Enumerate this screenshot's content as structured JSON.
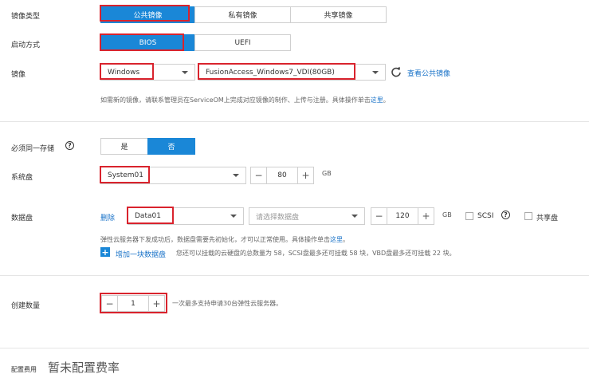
{
  "image_type": {
    "label": "镜像类型",
    "options": [
      "公共镜像",
      "私有镜像",
      "共享镜像"
    ],
    "selected": "公共镜像"
  },
  "boot_mode": {
    "label": "启动方式",
    "options": [
      "BIOS",
      "UEFI"
    ],
    "selected": "BIOS"
  },
  "image": {
    "label": "镜像",
    "os_value": "Windows",
    "image_value": "FusionAccess_Windows7_VDI(80GB)",
    "view_public_link": "查看公共镜像",
    "hint_prefix": "如需新的镜像，请联系管理员在ServiceOM上完成对应镜像的制作、上传与注册。具体操作单击",
    "hint_link": "这里",
    "hint_suffix": "。"
  },
  "same_storage": {
    "label": "必须同一存储",
    "options": [
      "是",
      "否"
    ],
    "selected": "否"
  },
  "system_disk": {
    "label": "系统盘",
    "type_value": "System01",
    "size": "80",
    "unit": "GB"
  },
  "data_disk": {
    "label": "数据盘",
    "delete_label": "删除",
    "type_value": "Data01",
    "select_placeholder": "请选择数据盘",
    "size": "120",
    "unit": "GB",
    "scsi_label": "SCSI",
    "shared_label": "共享盘",
    "hint_prefix": "弹性云服务器下发成功后，数据盘需要先初始化，才可以正常使用。具体操作单击",
    "hint_link": "这里",
    "hint_suffix": "。",
    "add_label": "增加一块数据盘",
    "add_hint": "您还可以挂载的云硬盘的总数量为 58，SCSI盘最多还可挂载 58 块，VBD盘最多还可挂载 22 块。"
  },
  "quantity": {
    "label": "创建数量",
    "value": "1",
    "hint": "一次最多支持申请30台弹性云服务器。"
  },
  "fee": {
    "label": "配置费用",
    "value": "暂未配置费率"
  },
  "steppers": {
    "minus": "−",
    "plus": "+"
  },
  "icons": {
    "refresh": "refresh-icon",
    "help": "help-icon",
    "caret": "chevron-down-icon",
    "add": "plus-icon"
  },
  "colors": {
    "accent": "#1a87d7",
    "highlight": "#d9232d",
    "link": "#1a73c8"
  }
}
